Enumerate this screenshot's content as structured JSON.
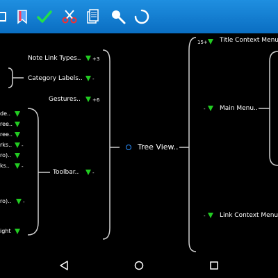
{
  "colors": {
    "toolbar": "#1a86d6",
    "accent_green": "#22cc22",
    "connector": "#cfcfcf"
  },
  "toolbar": {
    "icons": [
      "partial-icon",
      "bookmark-icon",
      "checkmark-icon",
      "scissors-icon",
      "document-icon",
      "search-icon",
      "loading-icon"
    ]
  },
  "left_nodes": [
    {
      "label": "Note Link Types..",
      "mark": "+3"
    },
    {
      "label": "Category Labels..",
      "mark": "-"
    },
    {
      "label": "Gestures..",
      "mark": "+6"
    },
    {
      "label": "Toolbar..",
      "mark": "-"
    }
  ],
  "left_subitems": [
    {
      "label": "de..",
      "mark": ""
    },
    {
      "label": "ree..",
      "mark": ""
    },
    {
      "label": "ree..",
      "mark": ""
    },
    {
      "label": "rks..",
      "mark": "-"
    },
    {
      "label": "ro)..",
      "mark": ""
    },
    {
      "label": "ks..",
      "mark": "-"
    },
    {
      "label": "ro)..",
      "mark": "-"
    },
    {
      "label": "ight",
      "mark": ""
    }
  ],
  "center_node": {
    "label": "Tree View.."
  },
  "right_nodes": [
    {
      "label": "Title Context Menu..",
      "prefix": "15+"
    },
    {
      "label": "Main Menu..",
      "prefix": "-"
    },
    {
      "label": "Link Context Menu..",
      "prefix": "-"
    }
  ],
  "navbar": {
    "icons": [
      "back-icon",
      "home-icon",
      "recents-icon"
    ]
  }
}
